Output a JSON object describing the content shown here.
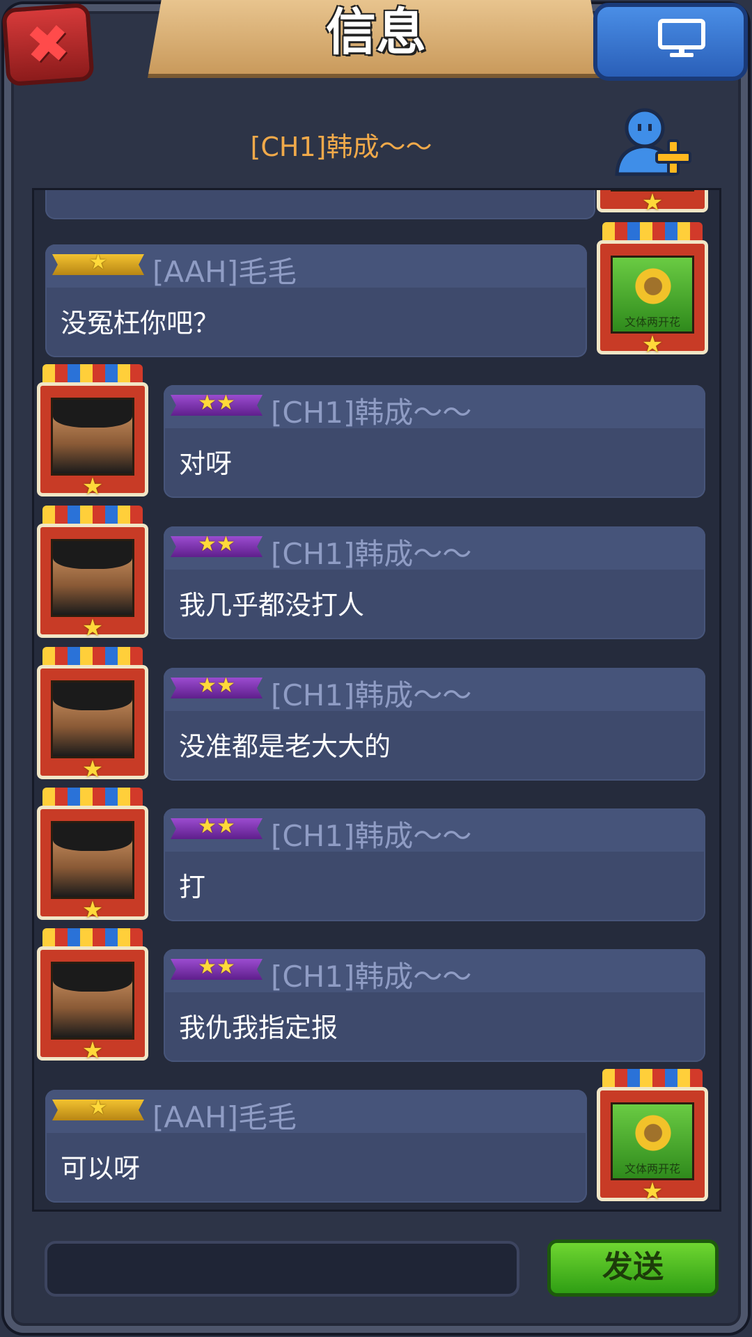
{
  "header": {
    "title": "信息",
    "close_icon": "close-icon",
    "screen_icon": "monitor-icon"
  },
  "chat": {
    "title": "[CH1]韩成～～",
    "add_friend_icon": "add-friend-icon"
  },
  "messages": [
    {
      "side": "right",
      "rank_stars": "★",
      "name": "[AAH]毛毛",
      "text": "没冤枉你吧？",
      "avatar": "sunflower-avatar",
      "avatar_label": "文体两开花"
    },
    {
      "side": "left",
      "rank_stars": "★★",
      "name": "[CH1]韩成～～",
      "text": "对呀",
      "avatar": "hero-avatar"
    },
    {
      "side": "left",
      "rank_stars": "★★",
      "name": "[CH1]韩成～～",
      "text": "我几乎都没打人",
      "avatar": "hero-avatar"
    },
    {
      "side": "left",
      "rank_stars": "★★",
      "name": "[CH1]韩成～～",
      "text": "没准都是老大大的",
      "avatar": "hero-avatar"
    },
    {
      "side": "left",
      "rank_stars": "★★",
      "name": "[CH1]韩成～～",
      "text": "打",
      "avatar": "hero-avatar"
    },
    {
      "side": "left",
      "rank_stars": "★★",
      "name": "[CH1]韩成～～",
      "text": "我仇我指定报",
      "avatar": "hero-avatar"
    },
    {
      "side": "right",
      "rank_stars": "★",
      "name": "[AAH]毛毛",
      "text": "可以呀",
      "avatar": "sunflower-avatar",
      "avatar_label": "文体两开花"
    }
  ],
  "avatar_star": "★",
  "composer": {
    "input_value": "",
    "send_label": "发送"
  },
  "colors": {
    "name": "#8f9cc4",
    "chat_title": "#f0a94a",
    "send_button": "#4cbf22",
    "close_button": "#c83030",
    "screen_button": "#3a7ad8"
  }
}
